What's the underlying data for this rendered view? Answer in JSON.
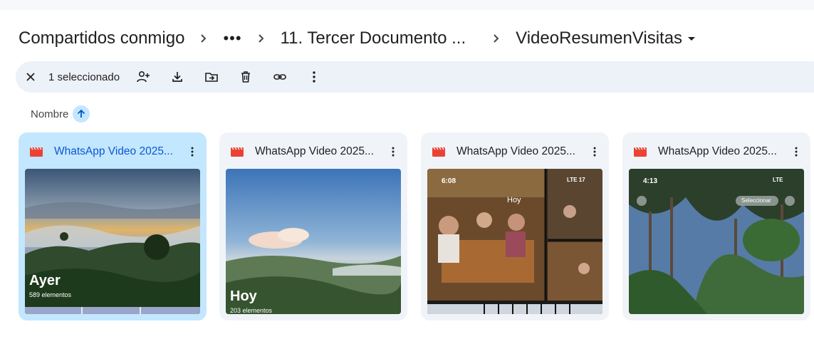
{
  "breadcrumb": {
    "root": "Compartidos conmigo",
    "more": "•••",
    "parent": "11. Tercer Documento ...",
    "current": "VideoResumenVisitas"
  },
  "toolbar": {
    "selected_text": "1 seleccionado"
  },
  "sort": {
    "label": "Nombre"
  },
  "colors": {
    "accent": "#0b57d0",
    "selected_bg": "#c2e7ff",
    "card_bg": "#f0f4f9",
    "video_icon": "#ea4335"
  },
  "files": [
    {
      "name": "WhatsApp Video 2025...",
      "selected": true,
      "thumb_title": "Ayer",
      "thumb_sub": "589 elementos"
    },
    {
      "name": "WhatsApp Video 2025...",
      "selected": false,
      "thumb_title": "Hoy",
      "thumb_sub": "203 elementos"
    },
    {
      "name": "WhatsApp Video 2025...",
      "selected": false,
      "thumb_time": "6:08",
      "thumb_title": "Hoy"
    },
    {
      "name": "WhatsApp Video 2025...",
      "selected": false,
      "thumb_time": "4:13",
      "thumb_button": "Seleccionar"
    }
  ]
}
